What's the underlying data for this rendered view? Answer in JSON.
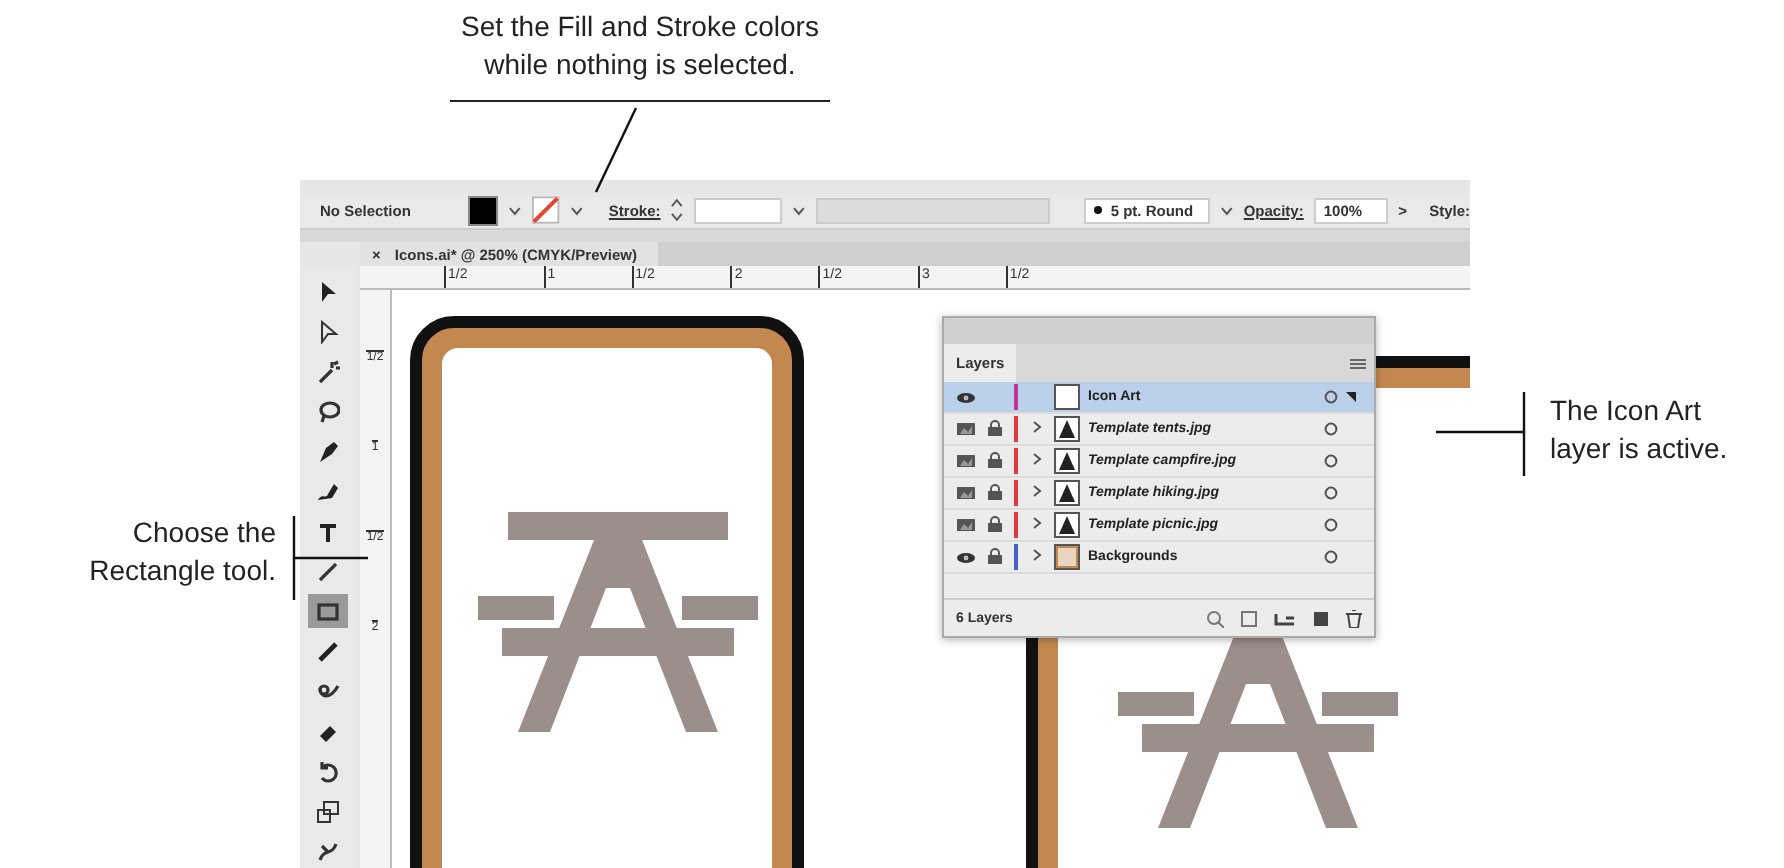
{
  "callouts": [
    {
      "kind": "top",
      "lines": [
        "Set the Fill and Stroke colors",
        "while nothing is selected."
      ]
    },
    {
      "kind": "left",
      "lines": [
        "Choose the",
        "Rectangle tool."
      ]
    },
    {
      "kind": "right",
      "lines": [
        "The Icon Art",
        "layer is active."
      ]
    }
  ],
  "control_bar": {
    "selection": "No Selection",
    "stroke_label": "Stroke:",
    "brush": "5 pt. Round",
    "opacity_label": "Opacity:",
    "opacity_value": "100%",
    "more": ">",
    "style_label": "Style:"
  },
  "document_tab": {
    "close": "×",
    "title": "Icons.ai* @ 250% (CMYK/Preview)"
  },
  "ruler": {
    "horizontal": [
      "1/2",
      "1",
      "1/2",
      "2",
      "1/2",
      "3",
      "1/2"
    ],
    "vertical": [
      "1/2",
      "1",
      "1/2",
      "2"
    ]
  },
  "tools": [
    {
      "kind": "selection",
      "selected": false
    },
    {
      "kind": "direct",
      "selected": false
    },
    {
      "kind": "wand",
      "selected": false
    },
    {
      "kind": "lasso",
      "selected": false
    },
    {
      "kind": "pen",
      "selected": false
    },
    {
      "kind": "curvature",
      "selected": false
    },
    {
      "kind": "type",
      "selected": false
    },
    {
      "kind": "line",
      "selected": false
    },
    {
      "kind": "rectangle",
      "selected": true
    },
    {
      "kind": "brush",
      "selected": false
    },
    {
      "kind": "shaper",
      "selected": false
    },
    {
      "kind": "eraser",
      "selected": false
    },
    {
      "kind": "rotate",
      "selected": false
    },
    {
      "kind": "scale",
      "selected": false
    },
    {
      "kind": "warp",
      "selected": false
    }
  ],
  "layers_panel": {
    "tab": "Layers",
    "footer": "6 Layers",
    "layers": [
      {
        "name": "Icon Art",
        "kind": "art",
        "locked": false,
        "expandable": false,
        "color": "#c0359a",
        "selected": true
      },
      {
        "name": "Template tents.jpg",
        "kind": "template",
        "locked": true,
        "expandable": true,
        "color": "#e5373a",
        "selected": false
      },
      {
        "name": "Template campfire.jpg",
        "kind": "template",
        "locked": true,
        "expandable": true,
        "color": "#e5373a",
        "selected": false
      },
      {
        "name": "Template hiking.jpg",
        "kind": "template",
        "locked": true,
        "expandable": true,
        "color": "#e5373a",
        "selected": false
      },
      {
        "name": "Template picnic.jpg",
        "kind": "template",
        "locked": true,
        "expandable": true,
        "color": "#e5373a",
        "selected": false
      },
      {
        "name": "Backgrounds",
        "kind": "background",
        "locked": true,
        "expandable": true,
        "color": "#4a5fc8",
        "selected": false
      }
    ]
  }
}
